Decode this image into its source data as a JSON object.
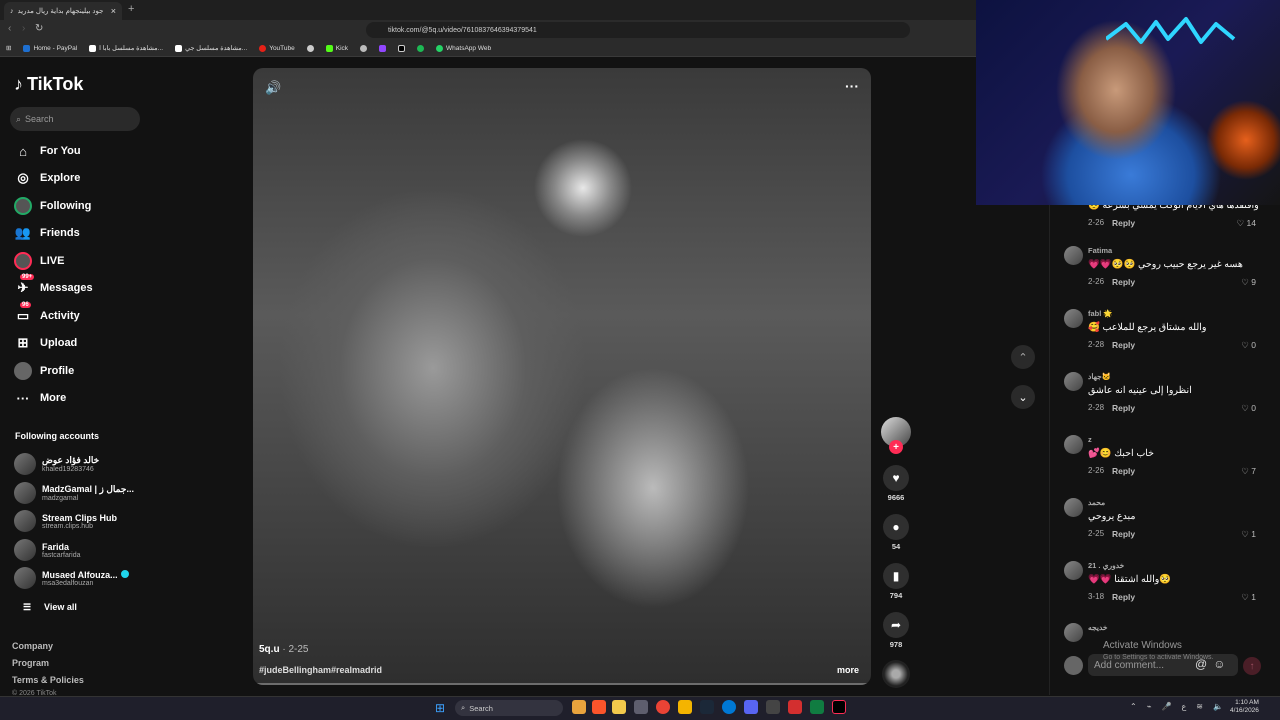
{
  "browser": {
    "tab_title": "جود بيلينجهام بداية ريال مدريد",
    "new_tab_symbol": "+",
    "url": "tiktok.com/@5q.u/video/7610837646394379541",
    "bookmarks": [
      "Home - PayPal",
      "مشاهدة مسلسل بابا ا...",
      "مشاهدة مسلسل جي...",
      "YouTube",
      "",
      "Kick",
      "",
      "",
      "",
      "",
      "WhatsApp Web"
    ]
  },
  "sidebar": {
    "logo": "TikTok",
    "search_placeholder": "Search",
    "nav": [
      {
        "label": "For You",
        "icon": "home-icon"
      },
      {
        "label": "Explore",
        "icon": "compass-icon"
      },
      {
        "label": "Following",
        "icon": "following-icon"
      },
      {
        "label": "Friends",
        "icon": "friends-icon"
      },
      {
        "label": "LIVE",
        "icon": "live-icon"
      },
      {
        "label": "Messages",
        "icon": "messages-icon",
        "badge": "99+"
      },
      {
        "label": "Activity",
        "icon": "activity-icon",
        "badge": "96"
      },
      {
        "label": "Upload",
        "icon": "upload-icon"
      },
      {
        "label": "Profile",
        "icon": "profile-icon"
      },
      {
        "label": "More",
        "icon": "more-icon"
      }
    ],
    "following_title": "Following accounts",
    "accounts": [
      {
        "name": "خالد فؤاد عوض",
        "handle": "khaled19283746"
      },
      {
        "name": "MadzGamal | جمال ز...",
        "handle": "madzgamal"
      },
      {
        "name": "Stream Clips Hub",
        "handle": "stream.clips.hub"
      },
      {
        "name": "Farida",
        "handle": "fastcarfarida"
      },
      {
        "name": "Musaed Alfouza...",
        "handle": "msa3edalfouzan"
      }
    ],
    "view_all": "View all",
    "footer": [
      "Company",
      "Program",
      "Terms & Policies",
      "© 2026 TikTok"
    ]
  },
  "video": {
    "author": "5q.u",
    "date": "· 2-25",
    "caption": "#judeBellingham#realmadrid",
    "more_label": "more"
  },
  "actions": {
    "likes": "9666",
    "comments": "54",
    "saves": "794",
    "shares": "978"
  },
  "comments": [
    {
      "user": "",
      "text": "وافتقدها هاي الايام الوكت يمشي بسرعة 😔",
      "date": "2-26",
      "reply": "Reply",
      "likes": "14"
    },
    {
      "user": "Fatima",
      "text": "هسه غير يرجع حبيب روحي 🥺🥺💗💗",
      "date": "2-26",
      "reply": "Reply",
      "likes": "9"
    },
    {
      "user": "fabl 🌟",
      "text": "والله مشتاق يرجع للملاعب 🥰",
      "date": "2-28",
      "reply": "Reply",
      "likes": "0"
    },
    {
      "user": "جهاد🐱",
      "text": "انظروا إلى عينيه انه عاشق",
      "date": "2-28",
      "reply": "Reply",
      "likes": "0"
    },
    {
      "user": "z",
      "text": "خاب احبك 😊💕",
      "date": "2-26",
      "reply": "Reply",
      "likes": "7"
    },
    {
      "user": "محمد",
      "text": "مبدع يروحي",
      "date": "2-25",
      "reply": "Reply",
      "likes": "1"
    },
    {
      "user": "خدوري . 21",
      "text": "🥺والله اشتقنا 💗💗",
      "date": "3-18",
      "reply": "Reply",
      "likes": "1"
    },
    {
      "user": "خديجه",
      "text": "",
      "date": "",
      "reply": "",
      "likes": ""
    }
  ],
  "comment_input": {
    "placeholder": "Add comment..."
  },
  "watermark": {
    "line1": "Activate Windows",
    "line2": "Go to Settings to activate Windows."
  },
  "taskbar": {
    "search": "Search",
    "time": "1:10 AM",
    "date": "4/16/2026",
    "lang": "ع"
  },
  "colors": {
    "accent": "#fe2c55",
    "background": "#121212",
    "verified": "#20d5ec"
  }
}
